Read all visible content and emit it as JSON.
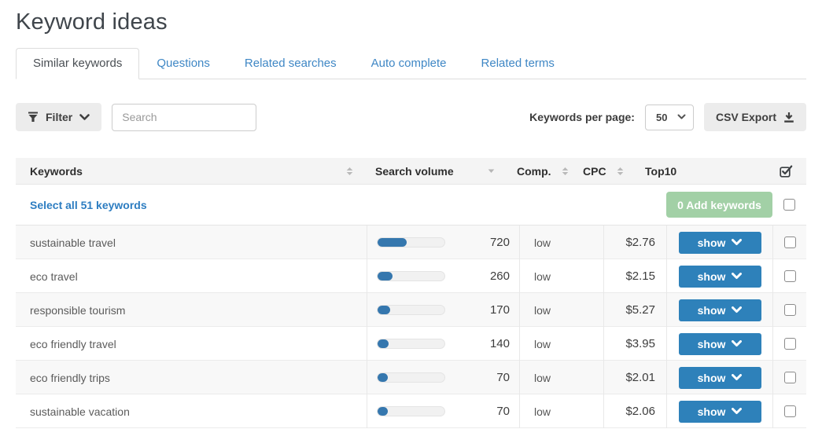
{
  "page": {
    "title": "Keyword ideas"
  },
  "tabs": [
    {
      "label": "Similar keywords",
      "active": true
    },
    {
      "label": "Questions",
      "active": false
    },
    {
      "label": "Related searches",
      "active": false
    },
    {
      "label": "Auto complete",
      "active": false
    },
    {
      "label": "Related terms",
      "active": false
    }
  ],
  "toolbar": {
    "filter_label": "Filter",
    "search_placeholder": "Search",
    "per_page_label": "Keywords per page:",
    "per_page_value": "50",
    "csv_export_label": "CSV Export"
  },
  "icons": {
    "filter": "funnel-icon",
    "chevron": "chevron-down-icon",
    "download": "download-icon",
    "sort_both": "sort-asc-desc-icon",
    "sort_desc": "sort-desc-icon",
    "select_all": "checked-box-icon"
  },
  "table": {
    "columns": {
      "keywords": "Keywords",
      "search_volume": "Search volume",
      "comp": "Comp.",
      "cpc": "CPC",
      "top10": "Top10"
    },
    "select_all_label": "Select all 51 keywords",
    "add_keywords_label": "0 Add keywords",
    "show_label": "show",
    "rows": [
      {
        "keyword": "sustainable travel",
        "volume": "720",
        "volume_pct": 43,
        "comp": "low",
        "cpc": "$2.76"
      },
      {
        "keyword": "eco travel",
        "volume": "260",
        "volume_pct": 22,
        "comp": "low",
        "cpc": "$2.15"
      },
      {
        "keyword": "responsible tourism",
        "volume": "170",
        "volume_pct": 19,
        "comp": "low",
        "cpc": "$5.27"
      },
      {
        "keyword": "eco friendly travel",
        "volume": "140",
        "volume_pct": 17,
        "comp": "low",
        "cpc": "$3.95"
      },
      {
        "keyword": "eco friendly trips",
        "volume": "70",
        "volume_pct": 15,
        "comp": "low",
        "cpc": "$2.01"
      },
      {
        "keyword": "sustainable vacation",
        "volume": "70",
        "volume_pct": 15,
        "comp": "low",
        "cpc": "$2.06"
      }
    ]
  },
  "colors": {
    "accent_blue": "#2e81ba",
    "bar_blue": "#3577ae",
    "tab_blue": "#3f87c5",
    "link_blue": "#2d7dc1",
    "green_button": "#a2d0a6",
    "header_bg": "#f4f4f4",
    "gray_button_bg": "#ececec"
  }
}
